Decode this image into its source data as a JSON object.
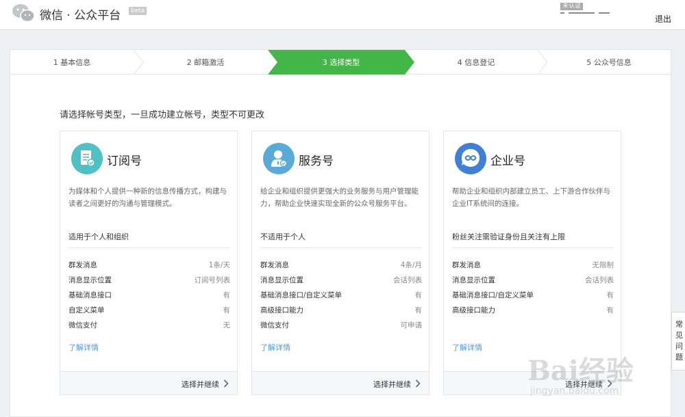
{
  "header": {
    "brand": "微信 · 公众平台",
    "beta": "beta",
    "verify": "未认证",
    "logout": "退出"
  },
  "steps": [
    {
      "label": "1 基本信息",
      "active": false
    },
    {
      "label": "2 邮箱激活",
      "active": false
    },
    {
      "label": "3 选择类型",
      "active": true
    },
    {
      "label": "4 信息登记",
      "active": false
    },
    {
      "label": "5 公众号信息",
      "active": false
    }
  ],
  "intro": "请选择帐号类型，一旦成功建立帐号，类型不可更改",
  "cards": [
    {
      "title": "订阅号",
      "icon": "subscription-icon",
      "color": "#4fc1c5",
      "desc": "为媒体和个人提供一种新的信息传播方式，构建与读者之间更好的沟通与管理模式。",
      "target": "适用于个人和组织",
      "features": [
        {
          "k": "群发消息",
          "v": "1条/天"
        },
        {
          "k": "消息显示位置",
          "v": "订阅号列表"
        },
        {
          "k": "基础消息接口",
          "v": "有"
        },
        {
          "k": "自定义菜单",
          "v": "有"
        },
        {
          "k": "微信支付",
          "v": "无"
        }
      ],
      "more": "了解详情",
      "action": "选择并继续"
    },
    {
      "title": "服务号",
      "icon": "service-icon",
      "color": "#5aaad8",
      "desc": "给企业和组织提供更强大的业务服务与用户管理能力，帮助企业快速实现全新的公众号服务平台。",
      "target": "不适用于个人",
      "features": [
        {
          "k": "群发消息",
          "v": "4条/月"
        },
        {
          "k": "消息显示位置",
          "v": "会话列表"
        },
        {
          "k": "基础消息接口/自定义菜单",
          "v": "有"
        },
        {
          "k": "高级接口能力",
          "v": "有"
        },
        {
          "k": "微信支付",
          "v": "可申请"
        }
      ],
      "more": "了解详情",
      "action": "选择并继续"
    },
    {
      "title": "企业号",
      "icon": "enterprise-icon",
      "color": "#3f7fd6",
      "desc": "帮助企业和组织内部建立员工、上下游合作伙伴与企业IT系统间的连接。",
      "target": "粉丝关注需验证身份且关注有上限",
      "features": [
        {
          "k": "群发消息",
          "v": "无限制"
        },
        {
          "k": "消息显示位置",
          "v": "会话列表"
        },
        {
          "k": "基础消息接口/自定义菜单",
          "v": "有"
        },
        {
          "k": "高级接口能力",
          "v": "有"
        }
      ],
      "more": "了解详情",
      "action": "选择并继续"
    }
  ],
  "faq": "常见问题",
  "watermark": {
    "t1": "Bai经验",
    "t2": "jingyan.baidu.com"
  },
  "colors": {
    "accent": "#44b549",
    "link": "#459ae9"
  }
}
